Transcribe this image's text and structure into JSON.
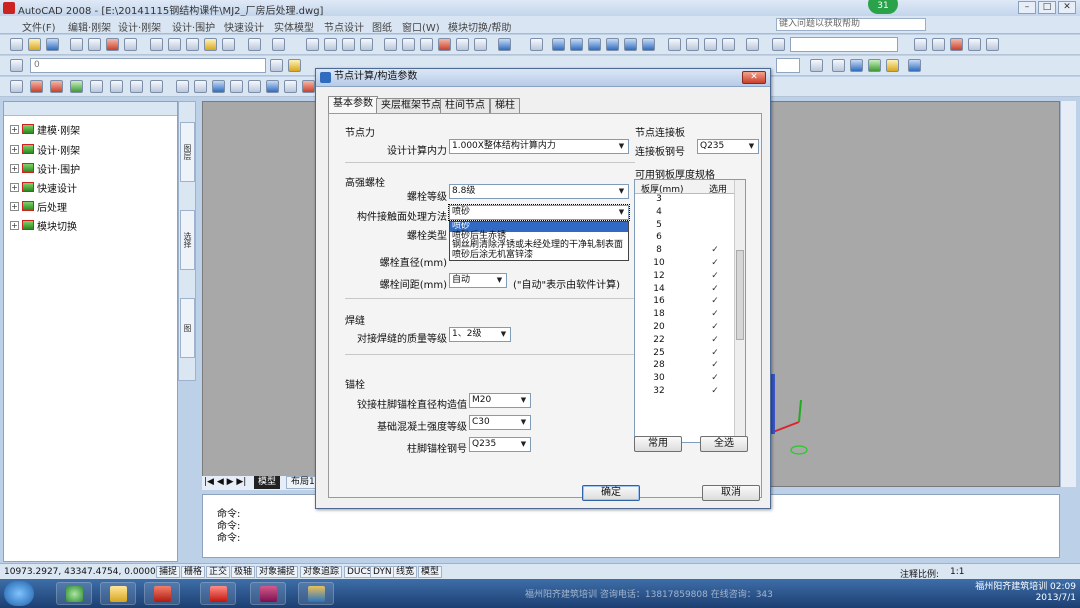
{
  "app": {
    "title": "AutoCAD 2008 - [E:\\20141115钢结构课件\\MJ2_厂房后处理.dwg]",
    "help_placeholder": "键入问题以获取帮助",
    "badge": "31"
  },
  "menu": [
    "文件(F)",
    "编辑·刚架",
    "设计·刚架",
    "设计·围护",
    "快速设计",
    "实体模型",
    "节点设计",
    "图纸",
    "窗口(W)",
    "模块切换/帮助"
  ],
  "layer_combo": "0",
  "tree": [
    "建模·刚架",
    "设计·刚架",
    "设计·围护",
    "快速设计",
    "后处理",
    "模块切换"
  ],
  "side_tabs": [
    "图层",
    "选择",
    "图"
  ],
  "layout_tabs": [
    "模型",
    "布局1"
  ],
  "command_lines": [
    "命令:",
    "命令:",
    "命令:"
  ],
  "status": {
    "coords": "10973.2927, 43347.4754, 0.0000",
    "toggles": [
      "捕捉",
      "栅格",
      "正交",
      "极轴",
      "对象捕捉",
      "对象追踪",
      "DUCS",
      "DYN",
      "线宽",
      "模型"
    ],
    "annotation_scale_label": "注释比例:",
    "annotation_scale": "1:1"
  },
  "taskbar": {
    "center_text": "福州阳齐建筑培训    咨询电话：13817859808    在线咨询：343",
    "right_text": "福州阳齐建筑培训 02:09",
    "date": "2013/7/1"
  },
  "dialog": {
    "title": "节点计算/构造参数",
    "tabs": [
      "基本参数",
      "夹层框架节点",
      "柱间节点",
      "梯柱"
    ],
    "node_force": {
      "section": "节点力",
      "label": "设计计算内力",
      "value": "1.000X整体结构计算内力"
    },
    "hsbolt": {
      "section": "高强螺栓",
      "grade_label": "螺栓等级",
      "grade_value": "8.8级",
      "method_label": "构件接触面处理方法",
      "method_value": "喷砂",
      "type_label": "螺栓类型",
      "method_options": [
        "喷砂",
        "喷砂后生赤锈",
        "钢丝刷清除浮锈或未经处理的干净轧制表面",
        "喷砂后涂无机富锌漆"
      ],
      "diameter_label": "螺栓直径(mm)",
      "spacing_label": "螺栓间距(mm)",
      "spacing_value": "自动",
      "spacing_note": "(\"自动\"表示由软件计算)"
    },
    "weld": {
      "section": "焊缝",
      "label": "对接焊缝的质量等级",
      "value": "1、2级"
    },
    "anchor": {
      "section": "锚栓",
      "dia_label": "铰接柱脚锚栓直径构造值",
      "dia_value": "M20",
      "concrete_label": "基础混凝土强度等级",
      "concrete_value": "C30",
      "steel_label": "柱脚锚栓钢号",
      "steel_value": "Q235"
    },
    "plate": {
      "section": "节点连接板",
      "label": "连接板钢号",
      "value": "Q235"
    },
    "thickness": {
      "section": "可用钢板厚度规格",
      "col_thickness": "板厚(mm)",
      "col_use": "选用",
      "rows": [
        {
          "t": "3",
          "use": ""
        },
        {
          "t": "4",
          "use": ""
        },
        {
          "t": "5",
          "use": ""
        },
        {
          "t": "6",
          "use": ""
        },
        {
          "t": "8",
          "use": "✓"
        },
        {
          "t": "10",
          "use": "✓"
        },
        {
          "t": "12",
          "use": "✓"
        },
        {
          "t": "14",
          "use": "✓"
        },
        {
          "t": "16",
          "use": "✓"
        },
        {
          "t": "18",
          "use": "✓"
        },
        {
          "t": "20",
          "use": "✓"
        },
        {
          "t": "22",
          "use": "✓"
        },
        {
          "t": "25",
          "use": "✓"
        },
        {
          "t": "28",
          "use": "✓"
        },
        {
          "t": "30",
          "use": "✓"
        },
        {
          "t": "32",
          "use": "✓"
        }
      ]
    },
    "buttons": {
      "common": "常用",
      "select_all": "全选",
      "ok": "确定",
      "cancel": "取消"
    }
  }
}
